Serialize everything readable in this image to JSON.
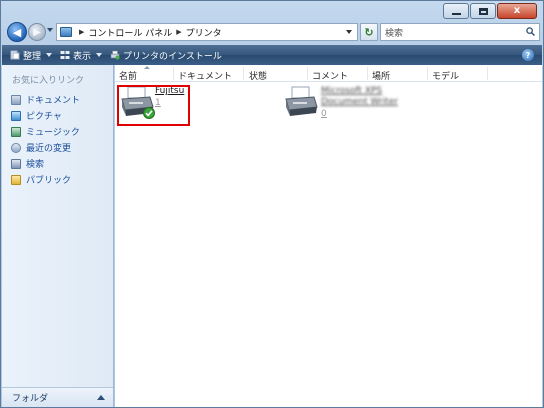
{
  "window": {
    "caption_buttons": [
      "minimize",
      "maximize",
      "close"
    ],
    "close_glyph": "x"
  },
  "address_bar": {
    "icon": "control-panel-icon",
    "breadcrumb": [
      "コントロール パネル",
      "プリンタ"
    ]
  },
  "search": {
    "placeholder": "検索"
  },
  "toolbar": {
    "organize": "整理",
    "views": "表示",
    "add_printer": "プリンタのインストール",
    "help": "?"
  },
  "sidebar": {
    "title": "お気に入りリンク",
    "items": [
      {
        "label": "ドキュメント",
        "icon": "documents-icon"
      },
      {
        "label": "ピクチャ",
        "icon": "pictures-icon"
      },
      {
        "label": "ミュージック",
        "icon": "music-icon"
      },
      {
        "label": "最近の変更",
        "icon": "recent-changes-icon"
      },
      {
        "label": "検索",
        "icon": "search-folder-icon"
      },
      {
        "label": "パブリック",
        "icon": "public-folder-icon"
      }
    ],
    "footer": "フォルダ"
  },
  "columns": [
    "名前",
    "ドキュメント",
    "状態",
    "コメント",
    "場所",
    "モデル"
  ],
  "printers": [
    {
      "name": "Fujitsu",
      "documents": "1",
      "default": true
    },
    {
      "name": "Microsoft XPS Document Writer",
      "documents": "0",
      "default": false
    }
  ],
  "colors": {
    "toolbar": "#35567c",
    "sidebar_link": "#1c4f9c",
    "highlight": "#e00000"
  }
}
